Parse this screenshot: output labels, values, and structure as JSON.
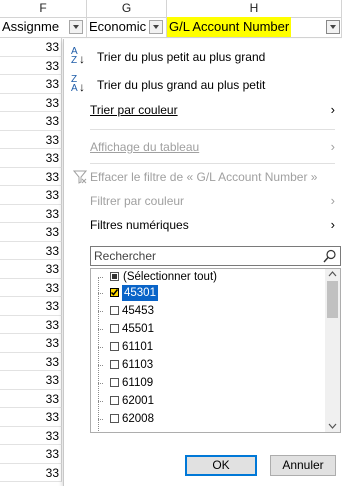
{
  "columns": [
    {
      "letter": "F"
    },
    {
      "letter": "G"
    },
    {
      "letter": "H"
    }
  ],
  "header": {
    "f_label": "Assignme",
    "g_label": "Economic",
    "h_label": "G/L Account Number"
  },
  "grid_value_fragment": "33",
  "menu": {
    "sort_asc": "Trier du plus petit au plus grand",
    "sort_desc": "Trier du plus grand au plus petit",
    "sort_by_color": "Trier par couleur",
    "sheet_view": "Affichage du tableau",
    "clear_filter": "Effacer le filtre de « G/L Account Number »",
    "filter_by_color": "Filtrer par couleur",
    "number_filters": "Filtres numériques"
  },
  "search": {
    "placeholder": "Rechercher"
  },
  "list": {
    "select_all": "(Sélectionner tout)",
    "items": [
      {
        "label": "45301",
        "checked": true
      },
      {
        "label": "45453",
        "checked": false
      },
      {
        "label": "45501",
        "checked": false
      },
      {
        "label": "61101",
        "checked": false
      },
      {
        "label": "61103",
        "checked": false
      },
      {
        "label": "61109",
        "checked": false
      },
      {
        "label": "62001",
        "checked": false
      },
      {
        "label": "62008",
        "checked": false
      }
    ]
  },
  "buttons": {
    "ok": "OK",
    "cancel": "Annuler"
  },
  "colors": {
    "header_highlight": "#ffff00",
    "selection": "#0a64c8",
    "ok_border": "#0078d7"
  }
}
